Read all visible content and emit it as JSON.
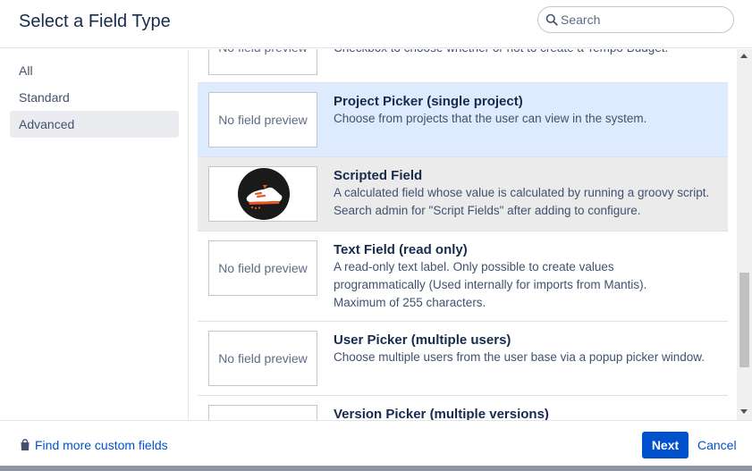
{
  "dialog": {
    "title": "Select a Field Type",
    "search": {
      "placeholder": "Search",
      "value": ""
    }
  },
  "sidebar": {
    "items": [
      {
        "label": "All",
        "active": false
      },
      {
        "label": "Standard",
        "active": false
      },
      {
        "label": "Advanced",
        "active": true
      }
    ]
  },
  "field_types": [
    {
      "name": "",
      "description": "Checkbox to choose whether or not to create a Tempo Budget.",
      "preview": "No field preview",
      "state": "normal"
    },
    {
      "name": "Project Picker (single project)",
      "description": "Choose from projects that the user can view in the system.",
      "preview": "No field preview",
      "state": "selected"
    },
    {
      "name": "Scripted Field",
      "description": "A calculated field whose value is calculated by running a groovy script. Search admin for \"Script Fields\" after adding to configure.",
      "preview": "",
      "preview_icon": "scriptrunner-shoe-logo",
      "state": "hovered"
    },
    {
      "name": "Text Field (read only)",
      "description": "A read-only text label. Only possible to create values programmatically (Used internally for imports from Mantis). Maximum of 255 characters.",
      "preview": "No field preview",
      "state": "normal"
    },
    {
      "name": "User Picker (multiple users)",
      "description": "Choose multiple users from the user base via a popup picker window.",
      "preview": "No field preview",
      "state": "normal"
    },
    {
      "name": "Version Picker (multiple versions)",
      "description": "",
      "preview": "",
      "state": "normal"
    }
  ],
  "footer": {
    "find_more_label": "Find more custom fields",
    "find_more_icon": "shopping-bag-icon",
    "next_label": "Next",
    "cancel_label": "Cancel"
  },
  "colors": {
    "primary": "#0052cc",
    "selected_row": "#deebff",
    "hover_row": "#ebebeb",
    "text": "#172b4d"
  }
}
